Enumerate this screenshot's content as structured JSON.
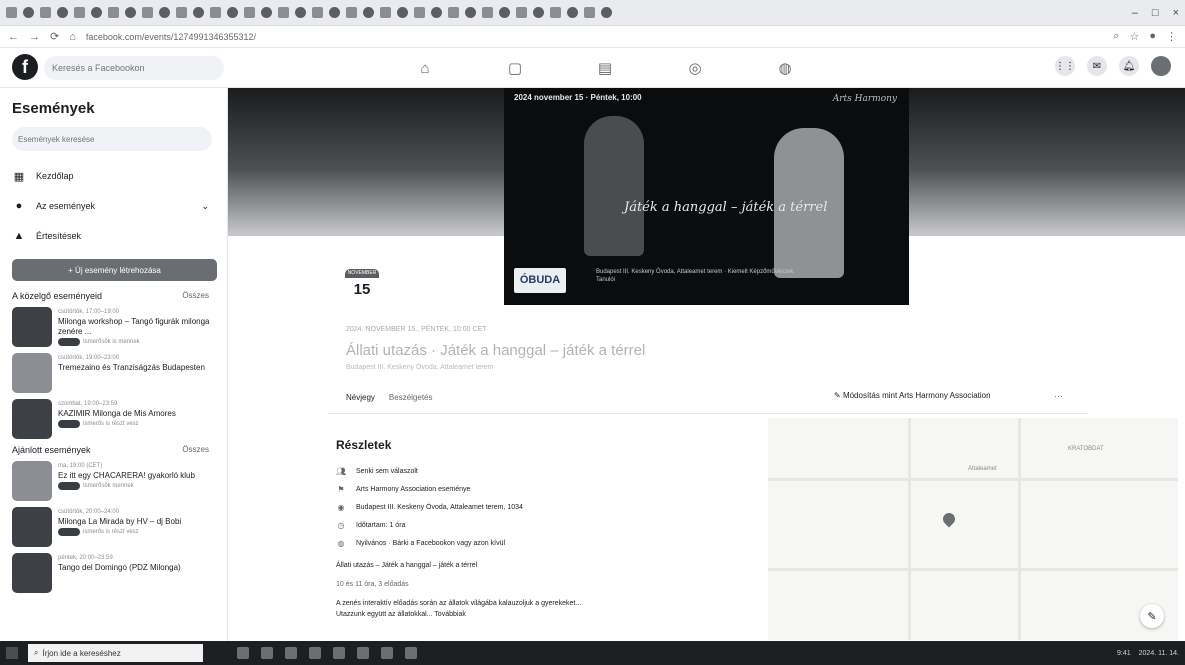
{
  "browser": {
    "url": "facebook.com/events/1274991346355312/",
    "window_controls": [
      "–",
      "□",
      "×"
    ]
  },
  "fb": {
    "logo": "f",
    "search_placeholder": "Keresés a Facebookon"
  },
  "sidebar": {
    "title": "Események",
    "search_placeholder": "Események keresése",
    "nav": [
      {
        "label": "Kezdőlap",
        "icon": "calendar-icon"
      },
      {
        "label": "Az események",
        "icon": "person-icon"
      },
      {
        "label": "Értesítések",
        "icon": "bell-icon"
      }
    ],
    "create_button": "+ Új esemény létrehozása",
    "upcoming": {
      "heading": "A közelgő eseményeid",
      "link": "Összes",
      "items": [
        {
          "date": "csütörtök, 17:00–19:00",
          "title": "Milonga workshop – Tangó figurák milonga zenére ...",
          "meta": "Ismerősök is mennek"
        },
        {
          "date": "csütörtök, 19:00–23:00",
          "title": "Tremezaino és Tranziságzás Budapesten",
          "meta": ""
        },
        {
          "date": "szombat, 19:00–23:59",
          "title": "KAZIMIR Milonga de Mis Amores",
          "meta": "ismerős is részt vesz"
        }
      ]
    },
    "suggested": {
      "heading": "Ajánlott események",
      "link": "Összes",
      "items": [
        {
          "date": "ma, 19:00 (CET)",
          "title": "Ez itt egy CHACARERA! gyakorló klub",
          "meta": "Ismerősök mennek"
        },
        {
          "date": "csütörtök, 20:00–24:00",
          "title": "Milonga La Mirada by HV – dj Bobi",
          "meta": "ismerős is részt vesz"
        },
        {
          "date": "péntek, 20:00–23:59",
          "title": "Tango del Domingo (PDZ Milonga)",
          "meta": ""
        }
      ]
    }
  },
  "event": {
    "poster_date": "2024 november 15 · Péntek, 10:00",
    "poster_org": "Arts Harmony",
    "poster_script": "Játék a hanggal – játék a térrel",
    "poster_logo": "ÓBUDA",
    "poster_info": "Budapest III. Keskeny Óvoda, Attaleamet terem · Kiemelt Képzőművészek Tanulói",
    "date_month": "NOVEMBER",
    "date_day": "15",
    "when": "2024. NOVEMBER 15., PÉNTEK, 10:00 CET",
    "title": "Állati utazás · Játék a hanggal – játék a térrel",
    "location": "Budapest III. Keskeny Óvoda, Attaleamet terem",
    "tabs": [
      "Névjegy",
      "Beszélgetés"
    ],
    "edit_label": "Módosítás mint Arts Harmony Association",
    "more": "···",
    "details_title": "Részletek",
    "details": [
      {
        "icon": "people-icon",
        "text": "Senki sem válaszolt"
      },
      {
        "icon": "flag-icon",
        "text": "Arts Harmony Association eseménye"
      },
      {
        "icon": "pin-icon",
        "text": "Budapest III. Keskeny Óvoda, Attaleamet terem, 1034"
      },
      {
        "icon": "clock-icon",
        "text": "Időtartam: 1 óra"
      },
      {
        "icon": "globe-icon",
        "text": "Nyilvános · Bárki a Facebookon vagy azon kívül"
      }
    ],
    "description": "Állati utazás – Játék a hanggal – játék a térrel",
    "description_time": "10 és 11 óra, 3 előadás",
    "description_more": "A zenés interaktív előadás során az állatok világába kalauzoljuk a gyerekeket...",
    "description_more2": "Utazzunk együtt az állatokkal... Továbbiak"
  },
  "map": {
    "labels": [
      "KRATOBDAT",
      "Attaleamet"
    ]
  },
  "taskbar": {
    "search_placeholder": "Írjon ide a kereséshez",
    "time": "9:41",
    "date": "2024. 11. 14."
  }
}
